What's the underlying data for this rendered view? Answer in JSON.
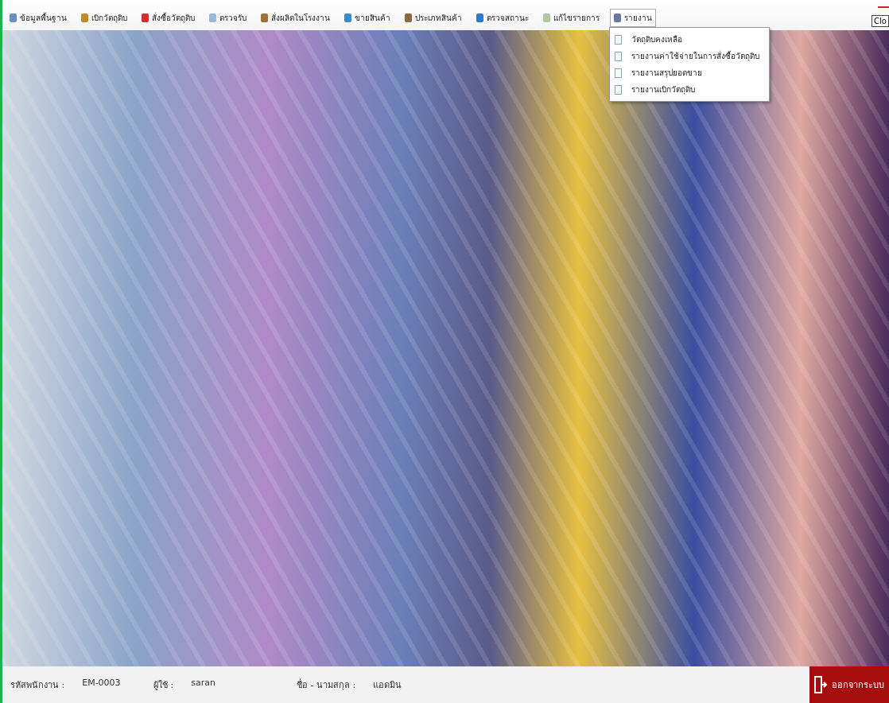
{
  "menu_bar": {
    "items": [
      {
        "label": "ข้อมูลพื้นฐาน",
        "selected": false,
        "color": "#6a8fc0"
      },
      {
        "label": "เบิกวัตถุดิบ",
        "selected": false,
        "color": "#c08a2a"
      },
      {
        "label": "สั่งซื้อวัตถุดิบ",
        "selected": false,
        "color": "#d0302a"
      },
      {
        "label": "ตรวจรับ",
        "selected": false,
        "color": "#9ab8d8"
      },
      {
        "label": "สั่งผลิตในโรงงาน",
        "selected": false,
        "color": "#a0703a"
      },
      {
        "label": "ขายสินค้า",
        "selected": false,
        "color": "#3a8ad0"
      },
      {
        "label": "ประเภทสินค้า",
        "selected": false,
        "color": "#8a6a3a"
      },
      {
        "label": "ตรวจสถานะ",
        "selected": false,
        "color": "#2a7ad0"
      },
      {
        "label": "แก้ไขรายการ",
        "selected": false,
        "color": "#b0c8a0"
      },
      {
        "label": "รายงาน",
        "selected": true,
        "color": "#6a7a9a"
      }
    ],
    "close_button": "Clo"
  },
  "report_menu": {
    "items": [
      "วัตถุดิบคงเหลือ",
      "รายงานค่าใช้จ่ายในการสั่งซื้อวัตถุดิบ",
      "รายงานสรุปยอดขาย",
      "รายงานเบิกวัตถุดิบ"
    ]
  },
  "status_bar": {
    "fields": [
      {
        "label": "รหัสพนักงาน :",
        "value": "EM-0003"
      },
      {
        "label": "ผู้ใช้ :",
        "value": "saran"
      },
      {
        "label": "ชื่อ - นามสกุล :",
        "value": "แอดมิน"
      }
    ],
    "logout_button": "ออกจากระบบ"
  }
}
